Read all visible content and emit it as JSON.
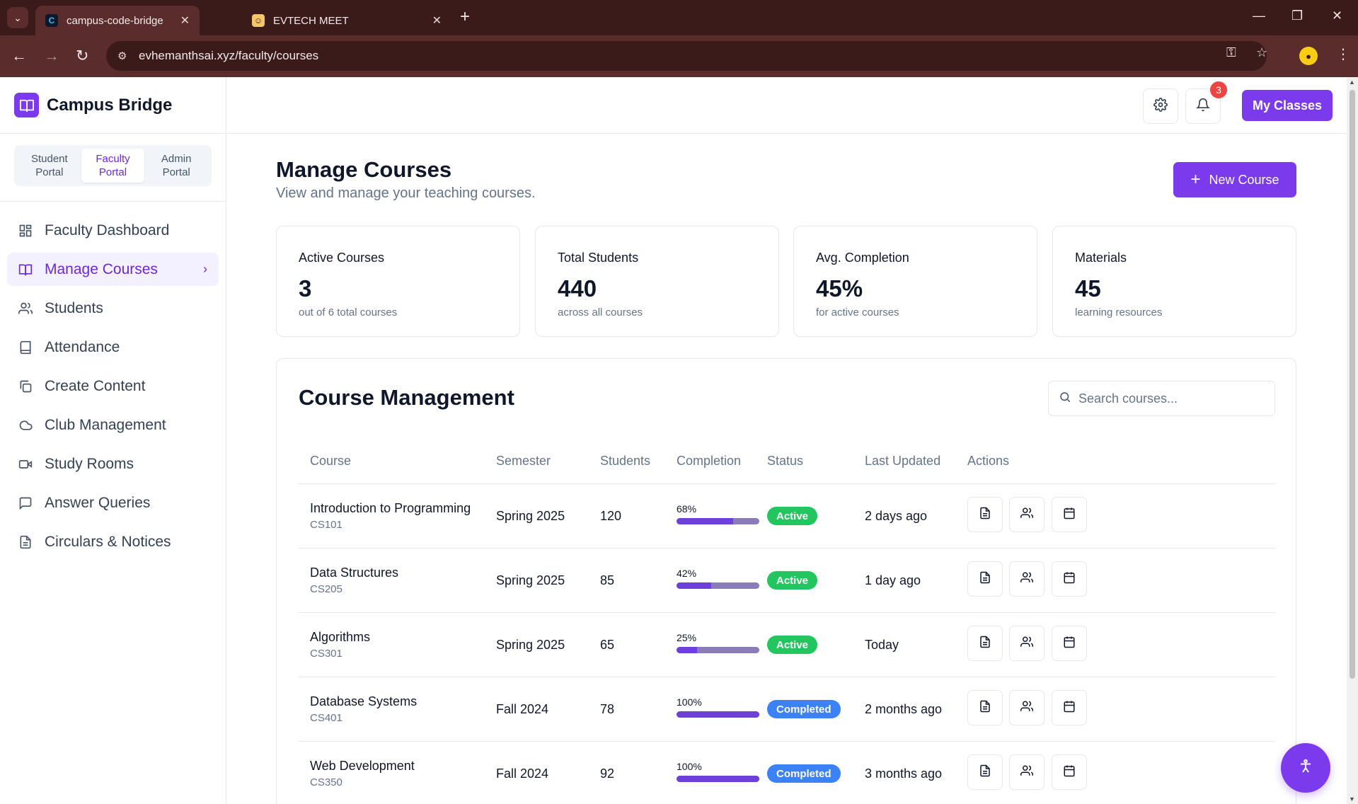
{
  "browser": {
    "tabs": [
      {
        "title": "campus-code-bridge",
        "favicon": "C",
        "active": true
      },
      {
        "title": "EVTECH MEET",
        "favicon": "meet-icon",
        "active": false
      }
    ],
    "url": "evhemanthsai.xyz/faculty/courses"
  },
  "brand": {
    "name": "Campus Bridge"
  },
  "portals": {
    "student_line1": "Student",
    "student_line2": "Portal",
    "faculty_line1": "Faculty",
    "faculty_line2": "Portal",
    "admin_line1": "Admin",
    "admin_line2": "Portal",
    "active": "faculty"
  },
  "sidebar": {
    "items": [
      {
        "label": "Faculty Dashboard",
        "icon": "dashboard-icon"
      },
      {
        "label": "Manage Courses",
        "icon": "book-icon",
        "active": true
      },
      {
        "label": "Students",
        "icon": "users-icon"
      },
      {
        "label": "Attendance",
        "icon": "bookmark-icon"
      },
      {
        "label": "Create Content",
        "icon": "copy-icon"
      },
      {
        "label": "Club Management",
        "icon": "cloud-icon"
      },
      {
        "label": "Study Rooms",
        "icon": "video-icon"
      },
      {
        "label": "Answer Queries",
        "icon": "message-icon"
      },
      {
        "label": "Circulars & Notices",
        "icon": "file-icon"
      }
    ]
  },
  "topbar": {
    "notification_count": "3",
    "my_classes_label": "My Classes"
  },
  "page": {
    "title": "Manage Courses",
    "subtitle": "View and manage your teaching courses.",
    "new_course_label": "New Course"
  },
  "stats": [
    {
      "label": "Active Courses",
      "value": "3",
      "note": "out of 6 total courses"
    },
    {
      "label": "Total Students",
      "value": "440",
      "note": "across all courses"
    },
    {
      "label": "Avg. Completion",
      "value": "45%",
      "note": "for active courses"
    },
    {
      "label": "Materials",
      "value": "45",
      "note": "learning resources"
    }
  ],
  "management": {
    "title": "Course Management",
    "search_placeholder": "Search courses...",
    "columns": [
      "Course",
      "Semester",
      "Students",
      "Completion",
      "Status",
      "Last Updated",
      "Actions"
    ],
    "rows": [
      {
        "name": "Introduction to Programming",
        "code": "CS101",
        "semester": "Spring 2025",
        "students": "120",
        "completion": "68%",
        "completion_value": 0.68,
        "status": "Active",
        "updated": "2 days ago"
      },
      {
        "name": "Data Structures",
        "code": "CS205",
        "semester": "Spring 2025",
        "students": "85",
        "completion": "42%",
        "completion_value": 0.42,
        "status": "Active",
        "updated": "1 day ago"
      },
      {
        "name": "Algorithms",
        "code": "CS301",
        "semester": "Spring 2025",
        "students": "65",
        "completion": "25%",
        "completion_value": 0.25,
        "status": "Active",
        "updated": "Today"
      },
      {
        "name": "Database Systems",
        "code": "CS401",
        "semester": "Fall 2024",
        "students": "78",
        "completion": "100%",
        "completion_value": 1.0,
        "status": "Completed",
        "updated": "2 months ago"
      },
      {
        "name": "Web Development",
        "code": "CS350",
        "semester": "Fall 2024",
        "students": "92",
        "completion": "100%",
        "completion_value": 1.0,
        "status": "Completed",
        "updated": "3 months ago"
      }
    ]
  },
  "colors": {
    "accent": "#7c3aed",
    "active_status": "#22c55e",
    "completed_status": "#3b82f6",
    "badge": "#ef4444"
  }
}
